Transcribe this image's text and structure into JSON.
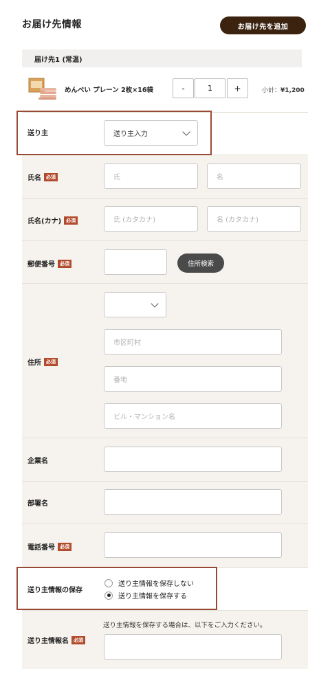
{
  "header": {
    "title": "お届け先情報",
    "add_button": "お届け先を追加"
  },
  "destination": {
    "label": "届け先1 (常温)"
  },
  "product": {
    "name": "めんべい プレーン 2枚×16袋",
    "minus": "-",
    "quantity": "1",
    "plus": "+",
    "subtotal_label": "小計：",
    "subtotal_value": "¥1,200"
  },
  "form": {
    "required_badge": "必須",
    "sender": {
      "label": "送り主",
      "value": "送り主入力"
    },
    "name": {
      "label": "氏名",
      "last_placeholder": "氏",
      "first_placeholder": "名"
    },
    "kana": {
      "label": "氏名(カナ)",
      "last_placeholder": "氏 (カタカナ)",
      "first_placeholder": "名 (カタカナ)"
    },
    "postal": {
      "label": "郵便番号",
      "search_button": "住所検索"
    },
    "address": {
      "label": "住所",
      "prefecture_value": "",
      "city_placeholder": "市区町村",
      "street_placeholder": "番地",
      "building_placeholder": "ビル・マンション名"
    },
    "company": {
      "label": "企業名"
    },
    "department": {
      "label": "部署名"
    },
    "phone": {
      "label": "電話番号"
    },
    "save_sender": {
      "label": "送り主情報の保存",
      "options": [
        "送り主情報を保存しない",
        "送り主情報を保存する"
      ],
      "selected_index": 1
    },
    "sender_info_name": {
      "label": "送り主情報名",
      "note": "送り主情報を保存する場合は、以下をご入力ください。"
    }
  },
  "colors": {
    "accent_dark": "#3b2310",
    "required": "#b24a2c",
    "highlight": "#9a4a34",
    "form_bg": "#f6f3ee"
  }
}
